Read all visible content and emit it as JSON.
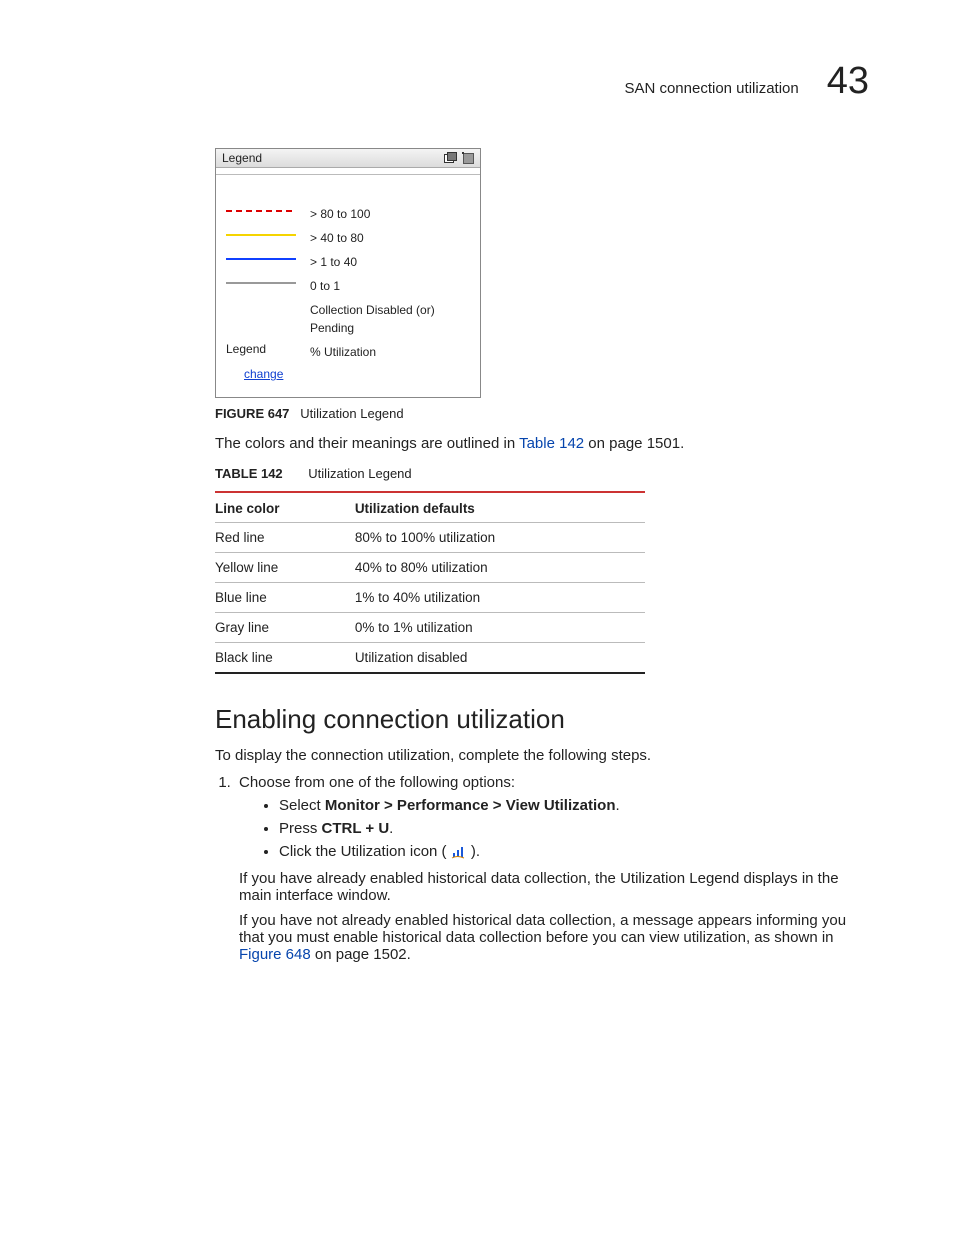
{
  "header": {
    "running_title": "SAN connection utilization",
    "chapter_number": "43"
  },
  "legend_panel": {
    "title": "Legend",
    "rows": [
      {
        "swatch_class": "dash-red",
        "label": "> 80 to 100"
      },
      {
        "swatch_class": "solid-yellow",
        "label": "> 40 to 80"
      },
      {
        "swatch_class": "solid-blue",
        "label": "> 1 to 40"
      },
      {
        "swatch_class": "solid-gray",
        "label": "0 to 1"
      },
      {
        "swatch_class": "",
        "label": "Collection Disabled (or) Pending"
      }
    ],
    "footer_left": "Legend",
    "footer_right": "% Utilization",
    "change_link": "change"
  },
  "figure_caption": {
    "label": "FIGURE 647",
    "text": "Utilization Legend"
  },
  "intro_para": {
    "before_link": "The colors and their meanings are outlined in ",
    "link_text": "Table 142",
    "after_link": " on page 1501."
  },
  "table_caption": {
    "label": "TABLE 142",
    "text": "Utilization Legend"
  },
  "table": {
    "headers": [
      "Line color",
      "Utilization defaults"
    ],
    "rows": [
      [
        "Red line",
        "80% to 100% utilization"
      ],
      [
        "Yellow line",
        "40% to 80% utilization"
      ],
      [
        "Blue line",
        "1% to 40% utilization"
      ],
      [
        "Gray line",
        "0% to 1% utilization"
      ],
      [
        "Black line",
        "Utilization disabled"
      ]
    ]
  },
  "section_heading": "Enabling connection utilization",
  "section_intro": "To display the connection utilization, complete the following steps.",
  "step1": {
    "text": "Choose from one of the following options:",
    "options": {
      "opt1_prefix": "Select ",
      "opt1_bold": "Monitor > Performance > View Utilization",
      "opt1_suffix": ".",
      "opt2_prefix": "Press ",
      "opt2_bold": "CTRL + U",
      "opt2_suffix": ".",
      "opt3_prefix": "Click the Utilization icon ( ",
      "opt3_suffix": " )."
    },
    "after1": "If you have already enabled historical data collection, the Utilization Legend displays in the main interface window.",
    "after2_before": "If you have not already enabled historical data collection, a message appears informing you that you must enable historical data collection before you can view utilization, as shown in ",
    "after2_link": "Figure 648",
    "after2_after": " on page 1502."
  }
}
